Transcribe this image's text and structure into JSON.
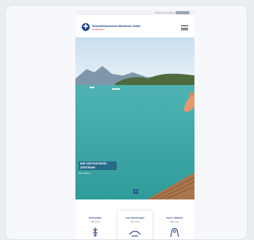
{
  "topbar": {
    "language": "Deutsch | English"
  },
  "header": {
    "brand_line1": "Gesundheitszentrum Wörthersee Velden",
    "brand_line2": "Rehabilitation"
  },
  "hero": {
    "title": "IHR ORTHOPÄDIE- ZENTRUM",
    "subtitle": "Mehr erfahren",
    "pager_label": "1"
  },
  "services": [
    {
      "title": "Orthopädie",
      "subtitle": "Mehr Infos"
    },
    {
      "title": "Live Schulungen",
      "subtitle": "Mehr Infos"
    },
    {
      "title": "Sport- Medizin",
      "subtitle": "Mehr Infos"
    }
  ],
  "colors": {
    "brand": "#1d3f86",
    "accent": "#e0356a",
    "water": "#3fb5ad"
  }
}
